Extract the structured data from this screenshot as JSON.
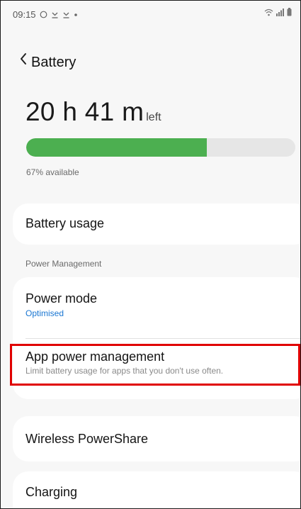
{
  "status_bar": {
    "time": "09:15",
    "left_icons": [
      "circle-outline-icon",
      "download-icon",
      "download-icon",
      "dot-icon"
    ],
    "right_icons": [
      "wifi-icon",
      "signal-icon",
      "battery-icon"
    ]
  },
  "header": {
    "back_icon": "chevron-left-icon",
    "title": "Battery"
  },
  "battery": {
    "time_main": "20 h 41 m",
    "time_suffix": "left",
    "level_fraction": 0.67,
    "available_text": "67% available",
    "fill_color": "#4caf50"
  },
  "menu": {
    "battery_usage": "Battery usage",
    "section_label": "Power Management",
    "power_mode_title": "Power mode",
    "power_mode_value": "Optimised",
    "app_power_title": "App power management",
    "app_power_sub": "Limit battery usage for apps that you don't use often.",
    "wireless_powershare": "Wireless PowerShare",
    "charging": "Charging"
  },
  "colors": {
    "accent_blue": "#1976d2",
    "highlight_red": "#e00000"
  }
}
